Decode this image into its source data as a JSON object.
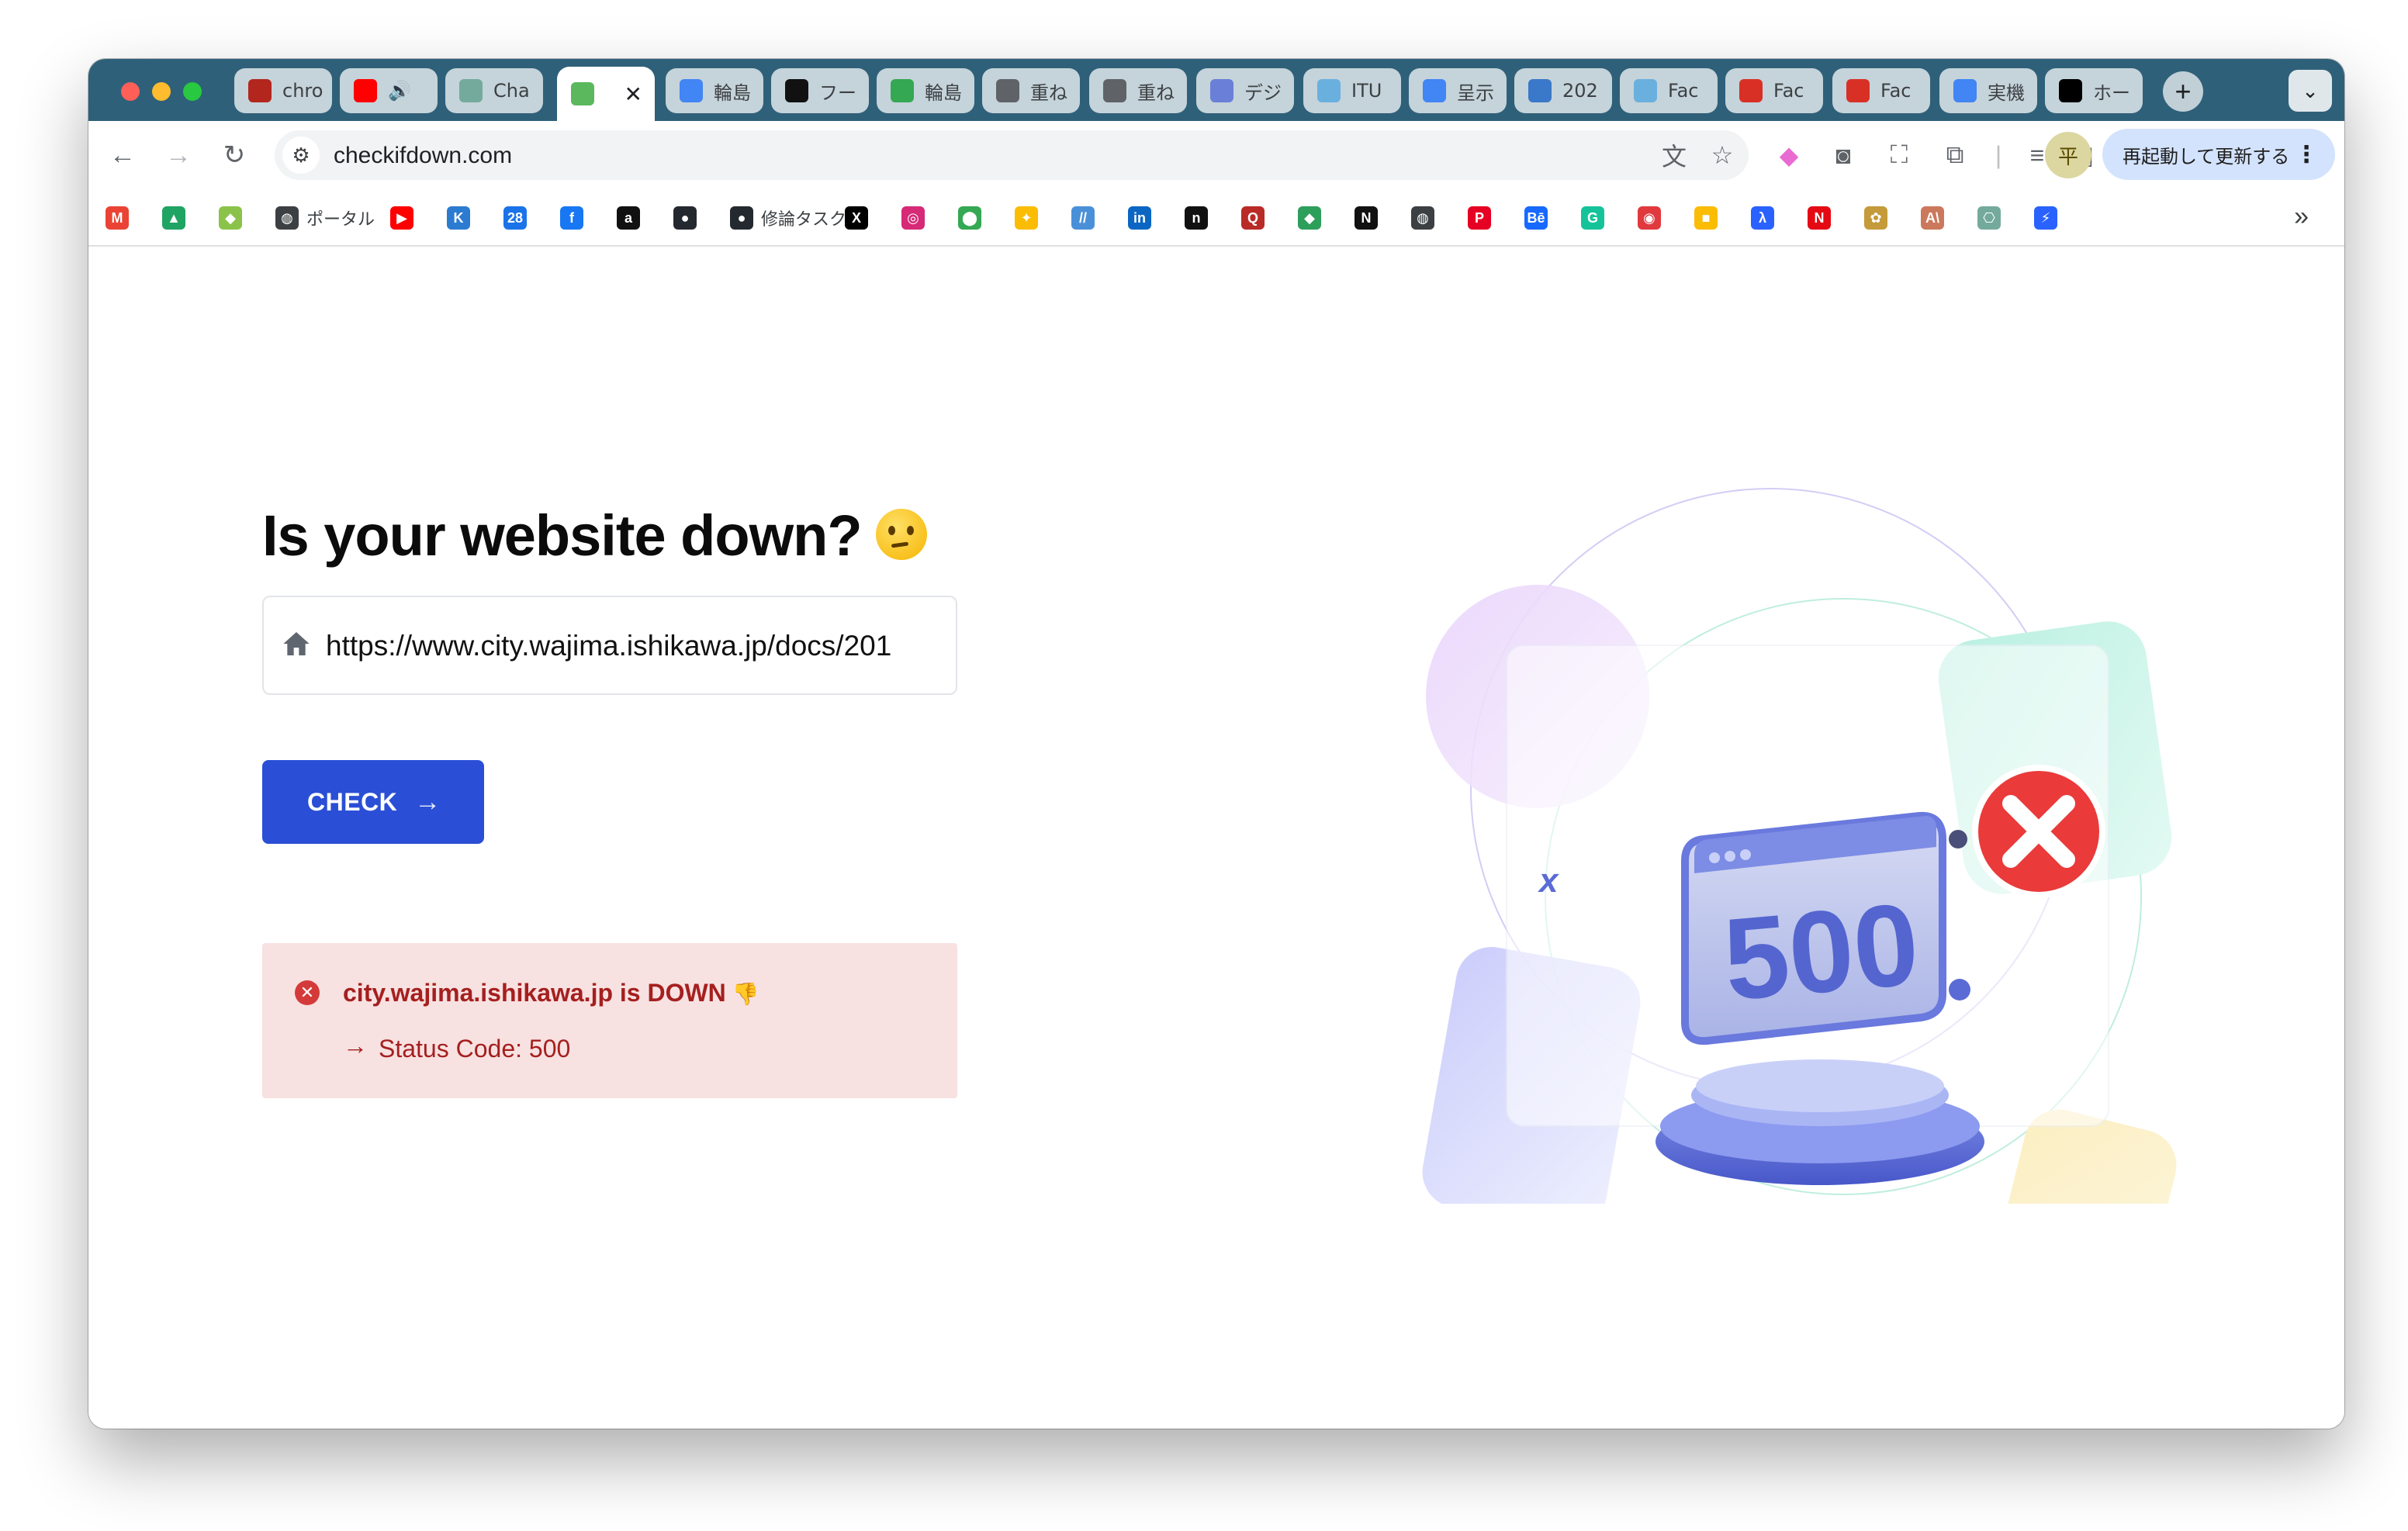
{
  "tabs": [
    {
      "label": "chro",
      "icon": "pdf-icon",
      "color": "#b3261e"
    },
    {
      "label": "",
      "icon": "youtube-icon",
      "color": "#ff0000",
      "audio": "🔊"
    },
    {
      "label": "Cha",
      "icon": "chatgpt-icon",
      "color": "#74aa9c"
    },
    {
      "label": "",
      "icon": "heart-icon",
      "color": "#5cb85c",
      "active": true
    },
    {
      "label": "輪島",
      "icon": "google-icon",
      "color": "#4285f4"
    },
    {
      "label": "フー",
      "icon": "amazon-icon",
      "color": "#111111"
    },
    {
      "label": "輪島",
      "icon": "maps-icon",
      "color": "#34a853"
    },
    {
      "label": "重ね",
      "icon": "globe-icon",
      "color": "#5f6368"
    },
    {
      "label": "重ね",
      "icon": "globe-icon",
      "color": "#5f6368"
    },
    {
      "label": "デジ",
      "icon": "site-icon",
      "color": "#6a7fd8"
    },
    {
      "label": "ITU",
      "icon": "itu-icon",
      "color": "#6ab0de"
    },
    {
      "label": "呈示",
      "icon": "google-icon",
      "color": "#4285f4"
    },
    {
      "label": "202",
      "icon": "doc-icon",
      "color": "#3a78c9"
    },
    {
      "label": "Fac",
      "icon": "site-icon",
      "color": "#6ab0de"
    },
    {
      "label": "Fac",
      "icon": "pdf-icon",
      "color": "#d93025"
    },
    {
      "label": "Fac",
      "icon": "pdf-icon",
      "color": "#d93025"
    },
    {
      "label": "実機",
      "icon": "google-icon",
      "color": "#4285f4"
    },
    {
      "label": "ホー",
      "icon": "x-icon",
      "color": "#000000"
    }
  ],
  "tab_close": "✕",
  "tab_new": "+",
  "tab_search": "⌄",
  "toolbar": {
    "back": "←",
    "forward": "→",
    "reload": "↻",
    "url": "checkifdown.com",
    "profile_initial": "平",
    "update_label": "再起動して更新する",
    "menu": "⋮"
  },
  "bookmarks": [
    {
      "icon": "gmail-icon",
      "glyph": "M",
      "color": "#ea4335",
      "label": ""
    },
    {
      "icon": "drive-icon",
      "glyph": "▲",
      "color": "#1fa463",
      "label": ""
    },
    {
      "icon": "leaf-icon",
      "glyph": "◆",
      "color": "#8bc34a",
      "label": ""
    },
    {
      "icon": "globe-icon",
      "glyph": "◍",
      "color": "#3c4043",
      "label": "ポータル"
    },
    {
      "icon": "youtube-icon",
      "glyph": "▶",
      "color": "#ff0000",
      "label": ""
    },
    {
      "icon": "app-icon",
      "glyph": "K",
      "color": "#2b7bd1",
      "label": ""
    },
    {
      "icon": "calendar-icon",
      "glyph": "28",
      "color": "#1a73e8",
      "label": ""
    },
    {
      "icon": "facebook-icon",
      "glyph": "f",
      "color": "#1877f2",
      "label": ""
    },
    {
      "icon": "amazon-icon",
      "glyph": "a",
      "color": "#111111",
      "label": ""
    },
    {
      "icon": "github-icon",
      "glyph": "●",
      "color": "#24292f",
      "label": ""
    },
    {
      "icon": "github-icon",
      "glyph": "●",
      "color": "#24292f",
      "label": "修論タスク"
    },
    {
      "icon": "x-icon",
      "glyph": "X",
      "color": "#000000",
      "label": ""
    },
    {
      "icon": "instagram-icon",
      "glyph": "◎",
      "color": "#d62976",
      "label": ""
    },
    {
      "icon": "maps-icon",
      "glyph": "⬤",
      "color": "#34a853",
      "label": ""
    },
    {
      "icon": "photos-icon",
      "glyph": "✦",
      "color": "#fbbc04",
      "label": ""
    },
    {
      "icon": "app-icon",
      "glyph": "//",
      "color": "#4a90d9",
      "label": ""
    },
    {
      "icon": "linkedin-icon",
      "glyph": "in",
      "color": "#0a66c2",
      "label": ""
    },
    {
      "icon": "app-icon",
      "glyph": "n",
      "color": "#111111",
      "label": ""
    },
    {
      "icon": "app-icon",
      "glyph": "Q",
      "color": "#b92b27",
      "label": ""
    },
    {
      "icon": "app-icon",
      "glyph": "◆",
      "color": "#2e9e5b",
      "label": ""
    },
    {
      "icon": "notion-icon",
      "glyph": "N",
      "color": "#111111",
      "label": ""
    },
    {
      "icon": "globe-icon",
      "glyph": "◍",
      "color": "#3c4043",
      "label": ""
    },
    {
      "icon": "pinterest-icon",
      "glyph": "P",
      "color": "#e60023",
      "label": ""
    },
    {
      "icon": "behance-icon",
      "glyph": "Bē",
      "color": "#1769ff",
      "label": ""
    },
    {
      "icon": "grammarly-icon",
      "glyph": "G",
      "color": "#15c39a",
      "label": ""
    },
    {
      "icon": "app-icon",
      "glyph": "◉",
      "color": "#e0393e",
      "label": ""
    },
    {
      "icon": "app-icon",
      "glyph": "■",
      "color": "#fbbc04",
      "label": ""
    },
    {
      "icon": "app-icon",
      "glyph": "λ",
      "color": "#2962ff",
      "label": ""
    },
    {
      "icon": "netflix-icon",
      "glyph": "N",
      "color": "#e50914",
      "label": ""
    },
    {
      "icon": "app-icon",
      "glyph": "✿",
      "color": "#c49a3a",
      "label": ""
    },
    {
      "icon": "anthropic-icon",
      "glyph": "A\\",
      "color": "#cc785c",
      "label": ""
    },
    {
      "icon": "chatgpt-icon",
      "glyph": "⎔",
      "color": "#74aa9c",
      "label": ""
    },
    {
      "icon": "app-icon",
      "glyph": "⚡",
      "color": "#2962ff",
      "label": ""
    }
  ],
  "bookmarks_more": "»",
  "main": {
    "headline": "Is your website down?",
    "input_value": "https://www.city.wajima.ishikawa.jp/docs/201",
    "check_label": "CHECK",
    "check_arrow": "→"
  },
  "alert": {
    "icon": "✕",
    "title": "city.wajima.ishikawa.jp is DOWN",
    "thumb": "👎",
    "arrow": "→",
    "detail": "Status Code: 500",
    "colors": {
      "bg": "#f8e1e1",
      "text": "#a51f1f"
    }
  },
  "illustration": {
    "code": "500"
  }
}
